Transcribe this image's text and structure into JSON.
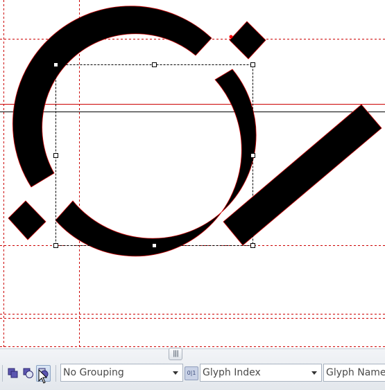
{
  "glyph_canvas": {
    "guide_color": "#cc0000",
    "outline_color": "#cc0000",
    "fill_color": "#000000",
    "baseline_color": "#000000",
    "selection_box_color": "#000000"
  },
  "toolbar": {
    "buttons": [
      {
        "icon": "union-shapes-icon"
      },
      {
        "icon": "subtract-shapes-icon"
      },
      {
        "icon": "intersect-shapes-icon",
        "pressed": true
      }
    ],
    "grouping_select": {
      "value": "No Grouping"
    },
    "sort_select": {
      "value": "Glyph Index"
    },
    "name_select": {
      "value": "Glyph Name"
    }
  }
}
